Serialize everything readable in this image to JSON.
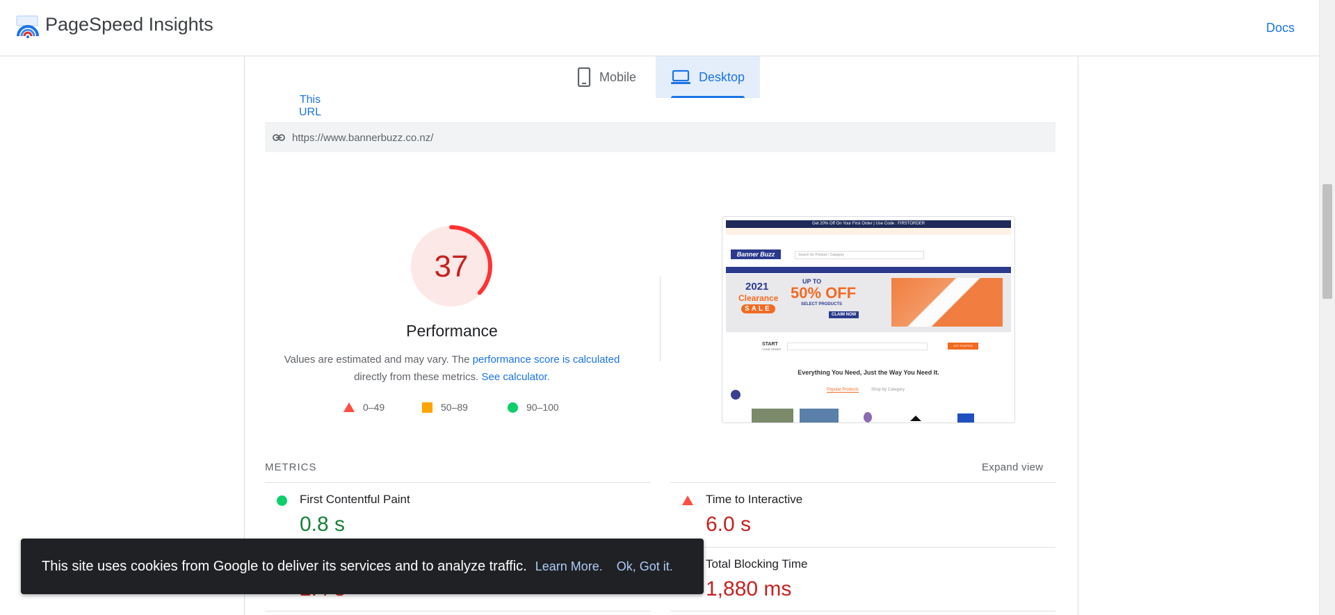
{
  "header": {
    "brand": "PageSpeed Insights",
    "docs_link": "Docs"
  },
  "tabs": [
    {
      "label": "Mobile",
      "icon": "phone-icon"
    },
    {
      "label": "Desktop",
      "icon": "laptop-icon",
      "selected": true
    }
  ],
  "subtab": {
    "label": "This URL"
  },
  "url": "https://www.bannerbuzz.co.nz/",
  "performance": {
    "score": "37",
    "score_fraction": 0.37,
    "title": "Performance",
    "note_prefix": "Values are estimated and may vary. The ",
    "note_link1": "performance score is calculated",
    "note_middle": " directly from these metrics. ",
    "note_link2": "See calculator.",
    "legend": [
      {
        "range": "0–49",
        "color": "#ff4e42",
        "shape": "triangle"
      },
      {
        "range": "50–89",
        "color": "#ffa400",
        "shape": "square"
      },
      {
        "range": "90–100",
        "color": "#0cce6b",
        "shape": "circle"
      }
    ]
  },
  "screenshot": {
    "promo_bar": "Get 20% Off On Your First Order | Use Code : FIRSTORDER",
    "logo": "Banner Buzz",
    "search_placeholder": "Search for Product / Category",
    "hero_year": "2021",
    "hero_clearance": "Clearance",
    "hero_sale": "SALE",
    "hero_upto": "UP TO",
    "hero_offer": "50% OFF",
    "hero_select": "SELECT PRODUCTS",
    "hero_cta": "CLAIM NOW",
    "start_label": "START",
    "start_sub": "YOUR ORDER",
    "get_started": "GET STARTED",
    "tagline": "Everything You Need, Just the Way You Need It.",
    "tab1": "Popular Products",
    "tab2": "Shop by Category"
  },
  "metrics": {
    "label": "METRICS",
    "expand": "Expand view",
    "items": [
      {
        "name": "First Contentful Paint",
        "value": "0.8 s",
        "status": "good"
      },
      {
        "name": "Time to Interactive",
        "value": "6.0 s",
        "status": "poor"
      },
      {
        "name": "Total Blocking Time",
        "value": "1,880 ms",
        "status": "poor"
      },
      {
        "name": "",
        "value": "2.4 s",
        "status": "poor"
      }
    ]
  },
  "cookie": {
    "message": "This site uses cookies from Google to deliver its services and to analyze traffic.",
    "learn": "Learn More.",
    "ok": "Ok, Got it."
  },
  "colors": {
    "accent": "#1a73e8",
    "poor": "#c5221f",
    "good": "#188038",
    "gauge_poor": "#ff3333",
    "gauge_bg": "#fce8e6"
  }
}
